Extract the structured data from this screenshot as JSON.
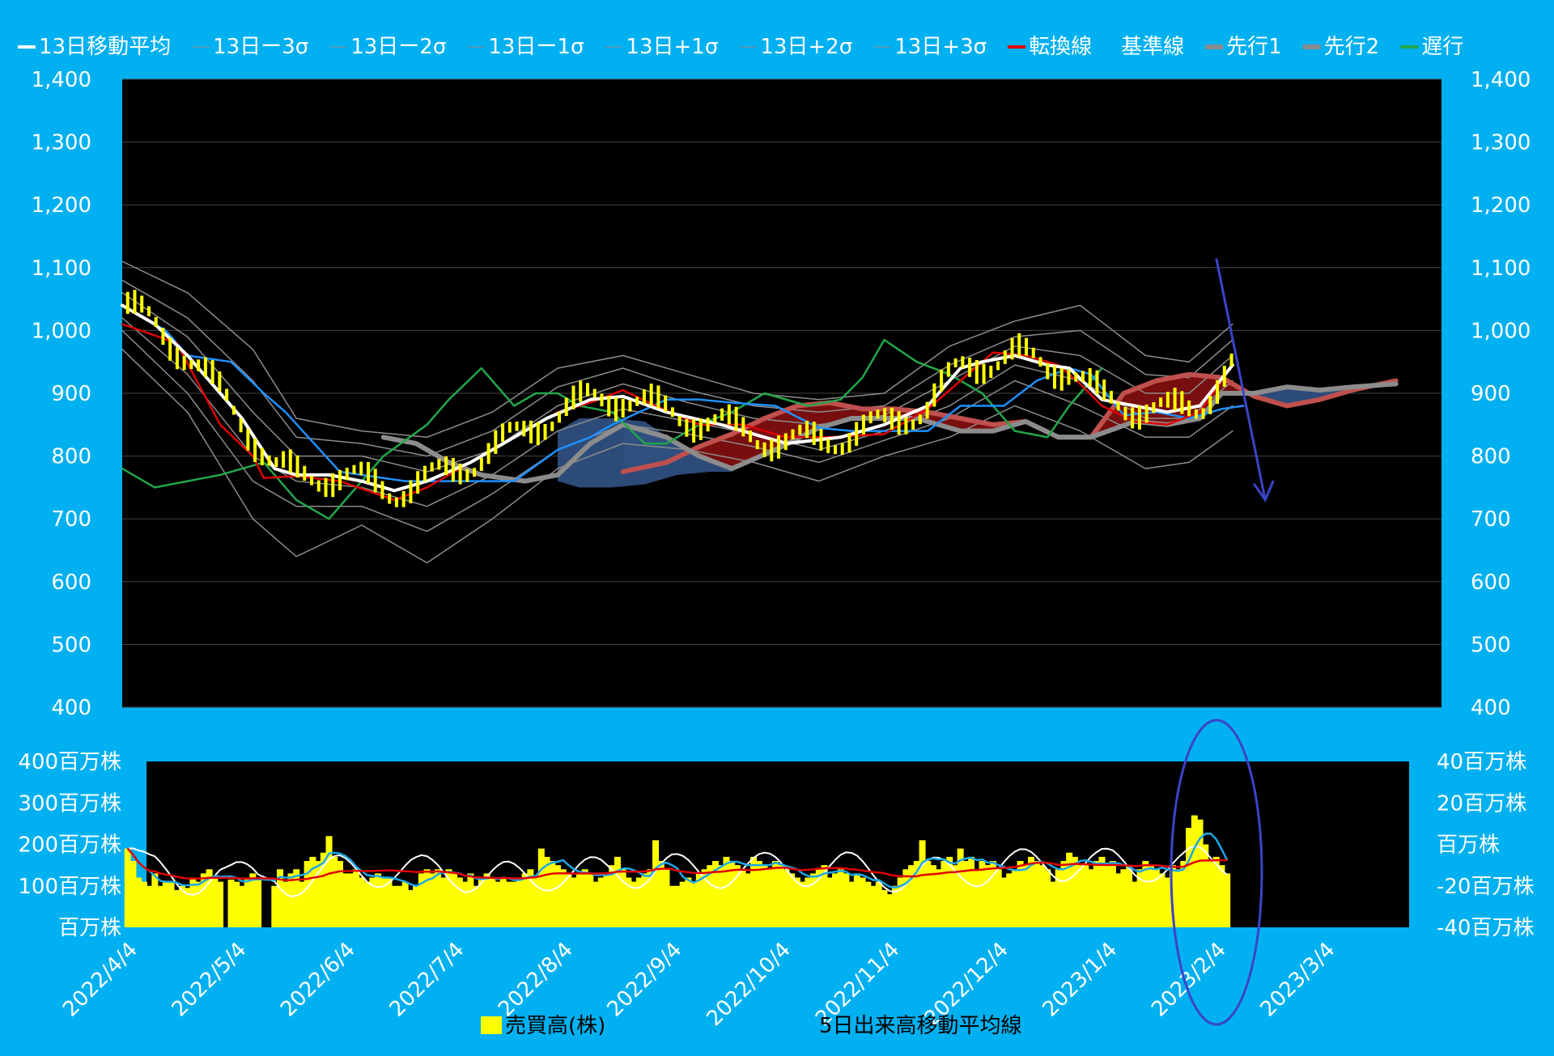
{
  "colors": {
    "background": "#00b0f0",
    "plot_bg": "#000000",
    "price": "#ffffff",
    "sigma": "#8c8c8c",
    "tenkan": "#e00000",
    "kijun": "#1e90ff",
    "senkou1": "#8c8c8c",
    "senkou2": "#c0504d",
    "chikou": "#22a64a",
    "cloud_bull": "#7f0f0f",
    "cloud_bear": "#2f4f7f",
    "candle": "#ffff00",
    "volume": "#ffff00",
    "vol_ma5": "#1ea7e8",
    "vol_ma25": "#e00000",
    "vol_line": "#ffffff",
    "annotation": "#3b44c8"
  },
  "legend": [
    {
      "label": "13日移動平均",
      "key": "price",
      "icon": "line"
    },
    {
      "label": "13日ー3σ",
      "key": "sigma",
      "icon": "thin-line"
    },
    {
      "label": "13日ー2σ",
      "key": "sigma",
      "icon": "thin-line"
    },
    {
      "label": "13日ー1σ",
      "key": "sigma",
      "icon": "thin-line"
    },
    {
      "label": "13日+1σ",
      "key": "sigma",
      "icon": "thin-line"
    },
    {
      "label": "13日+2σ",
      "key": "sigma",
      "icon": "thin-line"
    },
    {
      "label": "13日+3σ",
      "key": "sigma",
      "icon": "thin-line"
    },
    {
      "label": "転換線",
      "key": "tenkan",
      "icon": "line"
    },
    {
      "label": "基準線",
      "key": "kijun",
      "icon": "none"
    },
    {
      "label": "先行1",
      "key": "senkou1",
      "icon": "thick-line"
    },
    {
      "label": "先行2",
      "key": "senkou1",
      "icon": "thick-line"
    },
    {
      "label": "遅行",
      "key": "chikou",
      "icon": "line"
    }
  ],
  "chart_data": [
    {
      "type": "line",
      "name": "price-ichimoku",
      "x_ticks": [
        "2022/4/4",
        "2022/5/4",
        "2022/6/4",
        "2022/7/4",
        "2022/8/4",
        "2022/9/4",
        "2022/10/4",
        "2022/11/4",
        "2022/12/4",
        "2023/1/4",
        "2023/2/4",
        "2023/3/4"
      ],
      "ylim": [
        400,
        1400
      ],
      "y_ticks": [
        "400",
        "500",
        "600",
        "700",
        "800",
        "900",
        "1,000",
        "1,100",
        "1,200",
        "1,300",
        "1,400"
      ],
      "y_ticks_right": [
        "400",
        "500",
        "600",
        "700",
        "800",
        "900",
        "1,000",
        "1,100",
        "1,200",
        "1,300",
        "1,400"
      ],
      "grid": true,
      "series": [
        {
          "name": "13日移動平均",
          "x": [
            0,
            0.3,
            0.6,
            0.9,
            1.1,
            1.4,
            1.6,
            1.9,
            2.2,
            2.5,
            2.8,
            3.2,
            3.5,
            3.9,
            4.3,
            4.6,
            5.0,
            5.5,
            6.1,
            6.6,
            7.0,
            7.4,
            7.7,
            7.9,
            8.2,
            8.5,
            8.7,
            9.0,
            9.3,
            9.6,
            9.9,
            10.2
          ],
          "y": [
            1040,
            1010,
            960,
            900,
            860,
            780,
            770,
            770,
            760,
            745,
            760,
            790,
            820,
            860,
            890,
            895,
            870,
            850,
            820,
            830,
            850,
            880,
            940,
            950,
            960,
            945,
            940,
            890,
            880,
            870,
            880,
            945
          ]
        },
        {
          "name": "転換線",
          "x": [
            0,
            0.5,
            0.9,
            1.2,
            1.3,
            1.6,
            2.0,
            2.5,
            2.8,
            3.2,
            3.6,
            4.0,
            4.3,
            4.6,
            4.9,
            5.3,
            5.7,
            6.1,
            6.5,
            7.0,
            7.4,
            7.7,
            8.0,
            8.3,
            8.6,
            8.8,
            9.0,
            9.3,
            9.6,
            9.9,
            10.2
          ],
          "y": [
            1010,
            980,
            850,
            800,
            765,
            768,
            760,
            730,
            750,
            790,
            830,
            870,
            885,
            905,
            880,
            850,
            850,
            830,
            830,
            835,
            875,
            920,
            965,
            960,
            945,
            915,
            880,
            855,
            850,
            870,
            945
          ]
        },
        {
          "name": "基準線",
          "x": [
            0,
            0.4,
            0.6,
            1.0,
            1.3,
            1.5,
            2.0,
            2.6,
            2.9,
            3.2,
            3.6,
            4.0,
            4.3,
            4.5,
            5.0,
            5.3,
            5.6,
            6.0,
            6.4,
            6.7,
            7.0,
            7.4,
            7.7,
            8.1,
            8.4,
            8.7,
            8.9,
            9.2,
            9.5,
            9.8,
            10.1,
            10.3
          ],
          "y": [
            1040,
            1000,
            960,
            950,
            900,
            870,
            775,
            760,
            760,
            760,
            760,
            810,
            830,
            850,
            890,
            890,
            885,
            880,
            845,
            840,
            840,
            840,
            880,
            880,
            920,
            940,
            930,
            865,
            870,
            860,
            875,
            880
          ]
        },
        {
          "name": "遅行",
          "x": [
            0,
            0.3,
            0.6,
            0.9,
            1.3,
            1.6,
            1.9,
            2.2,
            2.4,
            2.8,
            3.0,
            3.3,
            3.6,
            3.8,
            4.0,
            4.2,
            4.5,
            4.8,
            5.0,
            5.3,
            5.6,
            5.9,
            6.3,
            6.6,
            6.8,
            7.0,
            7.3,
            7.6,
            7.9,
            8.2,
            8.5,
            8.7,
            9.0
          ],
          "y": [
            780,
            750,
            760,
            770,
            790,
            730,
            700,
            760,
            800,
            850,
            890,
            940,
            880,
            900,
            900,
            880,
            870,
            820,
            820,
            850,
            870,
            900,
            880,
            890,
            925,
            985,
            950,
            930,
            900,
            840,
            830,
            880,
            940
          ]
        },
        {
          "name": "先行1",
          "x": [
            2.4,
            2.7,
            3.0,
            3.3,
            3.7,
            4.0,
            4.3,
            4.6,
            5.0,
            5.3,
            5.6,
            6.0,
            6.4,
            6.7,
            7.0,
            7.3,
            7.7,
            8.0,
            8.3,
            8.6,
            8.9,
            9.3,
            9.6,
            9.9,
            10.1,
            10.4,
            10.7,
            11.0,
            11.3,
            11.7
          ],
          "y": [
            830,
            820,
            790,
            770,
            760,
            770,
            820,
            850,
            830,
            800,
            780,
            810,
            845,
            860,
            860,
            860,
            840,
            840,
            855,
            830,
            830,
            855,
            850,
            860,
            900,
            900,
            910,
            905,
            910,
            915
          ]
        },
        {
          "name": "先行2",
          "x": [
            4.6,
            5.0,
            5.3,
            5.6,
            5.9,
            6.2,
            6.5,
            6.8,
            7.1,
            7.4,
            7.7,
            8.0,
            8.3,
            8.6,
            8.9,
            9.2,
            9.5,
            9.8,
            10.1,
            10.4,
            10.7,
            11.0,
            11.3,
            11.7
          ],
          "y": [
            775,
            790,
            815,
            835,
            860,
            880,
            885,
            875,
            875,
            870,
            860,
            850,
            855,
            830,
            830,
            900,
            920,
            930,
            925,
            895,
            880,
            890,
            905,
            920
          ]
        },
        {
          "name": "13日+1σ",
          "x": [
            0,
            0.6,
            1.2,
            1.6,
            2.2,
            2.8,
            3.4,
            4.0,
            4.6,
            5.2,
            5.8,
            6.4,
            7.0,
            7.6,
            8.2,
            8.8,
            9.4,
            9.8,
            10.2
          ],
          "y": [
            1060,
            990,
            870,
            800,
            800,
            775,
            810,
            880,
            915,
            885,
            860,
            850,
            865,
            920,
            975,
            960,
            900,
            900,
            960
          ]
        },
        {
          "name": "13日ー1σ",
          "x": [
            0,
            0.6,
            1.2,
            1.6,
            2.2,
            2.8,
            3.4,
            4.0,
            4.6,
            5.2,
            5.8,
            6.4,
            7.0,
            7.6,
            8.2,
            8.8,
            9.4,
            9.8,
            10.2
          ],
          "y": [
            1020,
            930,
            800,
            760,
            750,
            720,
            770,
            840,
            875,
            855,
            835,
            810,
            840,
            880,
            945,
            920,
            860,
            860,
            920
          ]
        },
        {
          "name": "13日+2σ",
          "x": [
            0,
            0.6,
            1.2,
            1.6,
            2.2,
            2.8,
            3.4,
            4.0,
            4.6,
            5.2,
            5.8,
            6.4,
            7.0,
            7.6,
            8.2,
            8.8,
            9.4,
            9.8,
            10.2
          ],
          "y": [
            1080,
            1020,
            920,
            830,
            820,
            800,
            840,
            910,
            940,
            905,
            880,
            870,
            880,
            945,
            990,
            1000,
            930,
            925,
            985
          ]
        },
        {
          "name": "13日ー2σ",
          "x": [
            0,
            0.6,
            1.2,
            1.6,
            2.2,
            2.8,
            3.4,
            4.0,
            4.6,
            5.2,
            5.8,
            6.4,
            7.0,
            7.6,
            8.2,
            8.8,
            9.4,
            9.8,
            10.2
          ],
          "y": [
            1000,
            900,
            760,
            720,
            720,
            680,
            740,
            810,
            850,
            835,
            815,
            790,
            825,
            860,
            920,
            880,
            830,
            830,
            880
          ]
        },
        {
          "name": "13日+3σ",
          "x": [
            0,
            0.6,
            1.2,
            1.6,
            2.2,
            2.8,
            3.4,
            4.0,
            4.6,
            5.2,
            5.8,
            6.4,
            7.0,
            7.6,
            8.2,
            8.8,
            9.4,
            9.8,
            10.2
          ],
          "y": [
            1110,
            1060,
            970,
            860,
            840,
            830,
            870,
            940,
            960,
            930,
            900,
            890,
            900,
            975,
            1015,
            1040,
            960,
            950,
            1010
          ]
        },
        {
          "name": "13日ー3σ",
          "x": [
            0,
            0.6,
            1.2,
            1.6,
            2.2,
            2.8,
            3.4,
            4.0,
            4.6,
            5.2,
            5.8,
            6.4,
            7.0,
            7.6,
            8.2,
            8.8,
            9.4,
            9.8,
            10.2
          ],
          "y": [
            970,
            870,
            700,
            640,
            690,
            630,
            700,
            780,
            820,
            810,
            790,
            760,
            800,
            830,
            880,
            840,
            780,
            790,
            840
          ]
        }
      ],
      "annotation": {
        "type": "arrow",
        "from": [
          10.05,
          1115
        ],
        "to": [
          10.5,
          730
        ]
      }
    },
    {
      "type": "bar",
      "name": "volume",
      "ylabel_left_ticks": [
        "百万株",
        "100百万株",
        "200百万株",
        "300百万株",
        "400百万株"
      ],
      "ylabel_right_ticks": [
        "-40百万株",
        "-20百万株",
        "百万株",
        "20百万株",
        "40百万株"
      ],
      "ylim": [
        0,
        400
      ],
      "x_ticks": [
        "2022/4/4",
        "2022/5/4",
        "2022/6/4",
        "2022/7/4",
        "2022/8/4",
        "2022/9/4",
        "2022/10/4",
        "2022/11/4",
        "2022/12/4",
        "2023/1/4",
        "2023/2/4",
        "2023/3/4"
      ],
      "legend": [
        {
          "label": "売買高(株)"
        },
        {
          "label": "5日出来高移動平均線"
        }
      ],
      "bars_x": [
        0.05,
        0.1,
        0.15,
        0.2,
        0.25,
        0.3,
        0.35,
        0.4,
        0.45,
        0.5,
        0.55,
        0.6,
        0.65,
        0.7,
        0.75,
        0.8,
        0.85,
        0.9,
        1.0,
        1.05,
        1.1,
        1.15,
        1.2,
        1.25,
        1.4,
        1.45,
        1.5,
        1.55,
        1.6,
        1.65,
        1.7,
        1.75,
        1.8,
        1.85,
        1.9,
        1.95,
        2.0,
        2.05,
        2.1,
        2.15,
        2.2,
        2.25,
        2.3,
        2.35,
        2.4,
        2.45,
        2.5,
        2.55,
        2.6,
        2.65,
        2.7,
        2.75,
        2.8,
        2.85,
        2.9,
        2.95,
        3.0,
        3.05,
        3.1,
        3.15,
        3.2,
        3.25,
        3.3,
        3.35,
        3.4,
        3.45,
        3.5,
        3.55,
        3.6,
        3.65,
        3.7,
        3.75,
        3.8,
        3.85,
        3.9,
        3.95,
        4.0,
        4.05,
        4.1,
        4.15,
        4.2,
        4.25,
        4.3,
        4.35,
        4.4,
        4.45,
        4.5,
        4.55,
        4.6,
        4.65,
        4.7,
        4.75,
        4.8,
        4.85,
        4.9,
        4.95,
        5.0,
        5.05,
        5.1,
        5.15,
        5.2,
        5.25,
        5.3,
        5.35,
        5.4,
        5.45,
        5.5,
        5.55,
        5.6,
        5.65,
        5.7,
        5.75,
        5.8,
        5.85,
        5.9,
        5.95,
        6.0,
        6.05,
        6.1,
        6.15,
        6.2,
        6.25,
        6.3,
        6.35,
        6.4,
        6.45,
        6.5,
        6.55,
        6.6,
        6.65,
        6.7,
        6.75,
        6.8,
        6.85,
        6.9,
        6.95,
        7.0,
        7.05,
        7.1,
        7.15,
        7.2,
        7.25,
        7.3,
        7.35,
        7.4,
        7.45,
        7.5,
        7.55,
        7.6,
        7.65,
        7.7,
        7.75,
        7.8,
        7.85,
        7.9,
        7.95,
        8.0,
        8.05,
        8.1,
        8.15,
        8.2,
        8.25,
        8.3,
        8.35,
        8.4,
        8.45,
        8.5,
        8.55,
        8.6,
        8.65,
        8.7,
        8.75,
        8.8,
        8.85,
        8.9,
        8.95,
        9.0,
        9.05,
        9.1,
        9.15,
        9.2,
        9.25,
        9.3,
        9.35,
        9.4,
        9.45,
        9.5,
        9.55,
        9.6,
        9.65,
        9.7,
        9.75,
        9.8,
        9.85,
        9.9,
        9.95,
        10.0,
        10.05,
        10.1,
        10.15,
        10.2
      ],
      "bars_y": [
        190,
        160,
        120,
        110,
        100,
        130,
        100,
        110,
        110,
        90,
        100,
        95,
        120,
        110,
        130,
        140,
        120,
        110,
        115,
        110,
        100,
        120,
        130,
        120,
        100,
        140,
        110,
        130,
        140,
        110,
        160,
        170,
        160,
        180,
        220,
        170,
        160,
        130,
        130,
        140,
        120,
        110,
        120,
        130,
        120,
        120,
        100,
        100,
        110,
        90,
        100,
        130,
        140,
        130,
        140,
        120,
        140,
        130,
        120,
        110,
        130,
        100,
        120,
        130,
        120,
        110,
        120,
        110,
        110,
        120,
        130,
        140,
        120,
        190,
        170,
        160,
        150,
        140,
        130,
        120,
        130,
        140,
        130,
        110,
        120,
        130,
        150,
        170,
        140,
        120,
        110,
        120,
        130,
        140,
        210,
        160,
        140,
        100,
        100,
        110,
        120,
        110,
        130,
        140,
        150,
        160,
        150,
        170,
        160,
        150,
        140,
        130,
        170,
        160,
        150,
        140,
        160,
        150,
        140,
        130,
        120,
        110,
        120,
        130,
        140,
        150,
        120,
        130,
        140,
        130,
        110,
        130,
        120,
        110,
        100,
        110,
        90,
        80,
        100,
        120,
        140,
        150,
        160,
        210,
        160,
        150,
        140,
        160,
        170,
        150,
        190,
        160,
        170,
        140,
        160,
        150,
        160,
        140,
        120,
        130,
        140,
        160,
        150,
        170,
        160,
        150,
        140,
        110,
        140,
        160,
        180,
        170,
        150,
        150,
        140,
        160,
        170,
        150,
        160,
        130,
        140,
        150,
        110,
        140,
        160,
        150,
        140,
        130,
        120,
        150,
        140,
        160,
        240,
        270,
        260,
        200,
        160,
        170,
        150,
        130
      ]
    }
  ]
}
